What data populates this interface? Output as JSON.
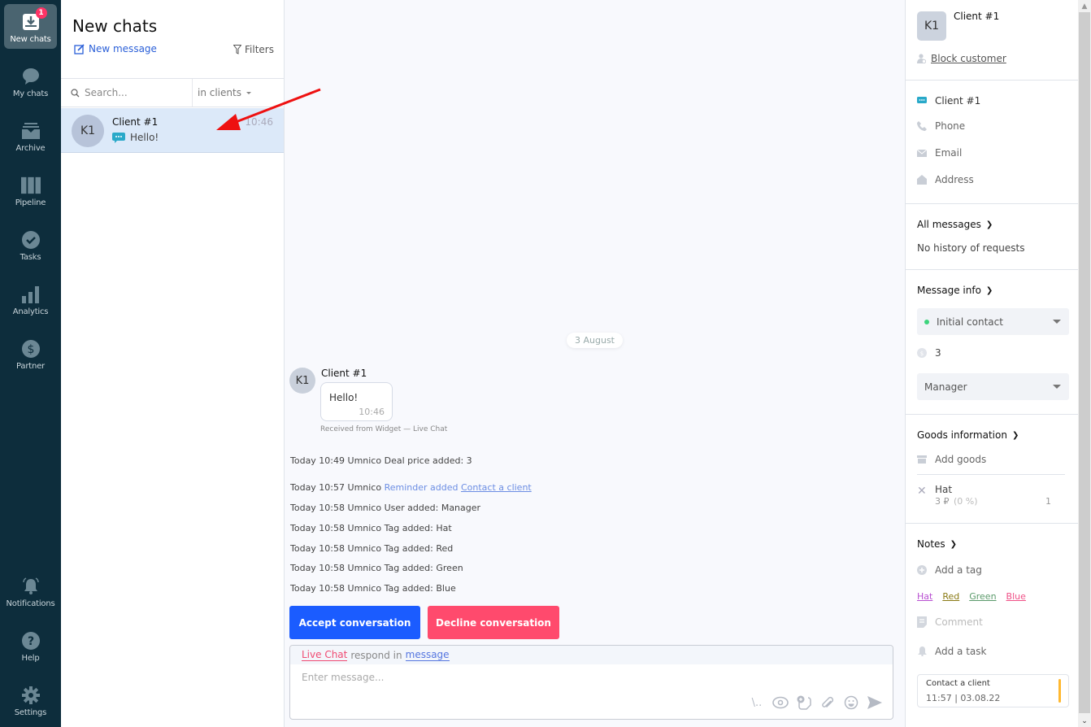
{
  "nav": {
    "items": [
      {
        "label": "New chats",
        "icon": "inbox-download-icon",
        "badge": "1",
        "active": true
      },
      {
        "label": "My chats",
        "icon": "speech-bubble-icon"
      },
      {
        "label": "Archive",
        "icon": "archive-box-icon"
      },
      {
        "label": "Pipeline",
        "icon": "pipeline-columns-icon"
      },
      {
        "label": "Tasks",
        "icon": "check-circle-icon"
      },
      {
        "label": "Analytics",
        "icon": "bar-chart-icon"
      },
      {
        "label": "Partner",
        "icon": "dollar-circle-icon"
      }
    ],
    "bottom_items": [
      {
        "label": "Notifications",
        "icon": "bell-icon"
      },
      {
        "label": "Help",
        "icon": "question-circle-icon"
      },
      {
        "label": "Settings",
        "icon": "gear-icon"
      }
    ]
  },
  "chat_list": {
    "title": "New chats",
    "new_message": "New message",
    "filters": "Filters",
    "search_placeholder": "Search...",
    "scope": "in clients",
    "chats": [
      {
        "initials": "K1",
        "name": "Client #1",
        "preview": "Hello!",
        "time": "10:46",
        "channel": "live-chat-icon"
      }
    ]
  },
  "conversation": {
    "date": "3 August",
    "message": {
      "initials": "K1",
      "author": "Client #1",
      "text": "Hello!",
      "time": "10:46",
      "source": "Received from Widget — Live Chat"
    },
    "log": [
      {
        "when": "Today 10:49",
        "who": "Umnico",
        "action": "Deal price added:",
        "value": "3"
      },
      {
        "when": "Today 10:57",
        "who": "Umnico",
        "action": "Reminder added",
        "link": "Contact a client"
      },
      {
        "when": "Today 10:58",
        "who": "Umnico",
        "action": "User added:",
        "value": "Manager"
      },
      {
        "when": "Today 10:58",
        "who": "Umnico",
        "action": "Tag added:",
        "value": "Hat"
      },
      {
        "when": "Today 10:58",
        "who": "Umnico",
        "action": "Tag added:",
        "value": "Red"
      },
      {
        "when": "Today 10:58",
        "who": "Umnico",
        "action": "Tag added:",
        "value": "Green"
      },
      {
        "when": "Today 10:58",
        "who": "Umnico",
        "action": "Tag added:",
        "value": "Blue"
      }
    ],
    "accept_label": "Accept conversation",
    "decline_label": "Decline conversation",
    "composer": {
      "channel": "Live Chat",
      "respond_in": "respond in",
      "mode": "message",
      "placeholder": "Enter message...",
      "tools": [
        "template-slash-icon",
        "eye-icon",
        "sticker-icon",
        "paperclip-icon",
        "emoji-icon",
        "send-icon"
      ],
      "template_glyph": "\\.."
    }
  },
  "client_panel": {
    "initials": "K1",
    "name": "Client #1",
    "block_label": "Block customer",
    "contacts": [
      {
        "icon": "live-chat-icon",
        "label": "Client #1"
      },
      {
        "icon": "phone-icon",
        "label": "Phone"
      },
      {
        "icon": "email-icon",
        "label": "Email"
      },
      {
        "icon": "house-icon",
        "label": "Address"
      }
    ],
    "all_messages": "All messages",
    "no_history": "No history of requests",
    "message_info": "Message info",
    "stage": "Initial contact",
    "stage_color": "#3dd47c",
    "deal_price": "3",
    "manager": "Manager",
    "goods_title": "Goods information",
    "add_goods": "Add goods",
    "goods": [
      {
        "name": "Hat",
        "price": "3 ₽",
        "discount": "(0 %)",
        "qty": "1"
      }
    ],
    "notes_title": "Notes",
    "add_tag": "Add a tag",
    "tags": [
      {
        "label": "Hat",
        "color": "#b84fd1"
      },
      {
        "label": "Red",
        "color": "#8a7a14"
      },
      {
        "label": "Green",
        "color": "#5a9a6a"
      },
      {
        "label": "Blue",
        "color": "#ef4f86"
      }
    ],
    "comment": "Comment",
    "add_task": "Add a task",
    "task": {
      "title": "Contact a client",
      "datetime": "11:57 | 03.08.22"
    }
  },
  "colors": {
    "nav_bg": "#0d2d3c",
    "accept": "#1b5cff",
    "decline": "#ff4a6d",
    "link": "#2a5fd8",
    "task_accent": "#ffb830",
    "annotation_arrow": "#ee1111"
  }
}
